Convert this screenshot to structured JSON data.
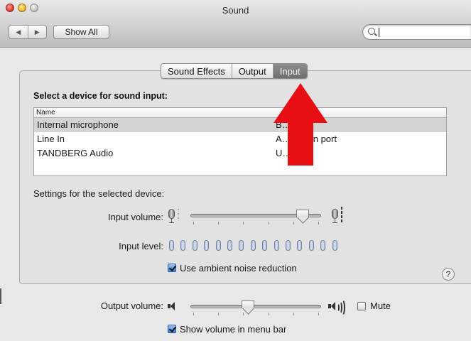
{
  "window": {
    "title": "Sound"
  },
  "toolbar": {
    "back_icon": "◀",
    "forward_icon": "▶",
    "show_all_label": "Show All",
    "search_value": ""
  },
  "tabs": [
    {
      "label": "Sound Effects",
      "selected": false
    },
    {
      "label": "Output",
      "selected": false
    },
    {
      "label": "Input",
      "selected": true
    }
  ],
  "input": {
    "device_heading": "Select a device for sound input:",
    "table": {
      "columns": [
        "Name",
        ""
      ],
      "rows": [
        {
          "name": "Internal microphone",
          "type": "B…n",
          "selected": true
        },
        {
          "name": "Line In",
          "type": "A… line-in port",
          "selected": false
        },
        {
          "name": "TANDBERG Audio",
          "type": "U…",
          "selected": false
        }
      ]
    },
    "settings_heading": "Settings for the selected device:",
    "input_volume_label": "Input volume:",
    "input_volume_fraction": 0.86,
    "input_level_label": "Input level:",
    "input_level_segments": 15,
    "input_level_active": 0,
    "ambient_noise_label": "Use ambient noise reduction",
    "ambient_noise_checked": true,
    "help_label": "?"
  },
  "output": {
    "output_volume_label": "Output volume:",
    "output_volume_fraction": 0.44,
    "mute_label": "Mute",
    "mute_checked": false,
    "show_volume_label": "Show volume in menu bar",
    "show_volume_checked": true
  },
  "colors": {
    "annotation_arrow": "#e80f14",
    "selected_tab": "#7d7d7d",
    "level_meter": "#a6b7cf"
  }
}
